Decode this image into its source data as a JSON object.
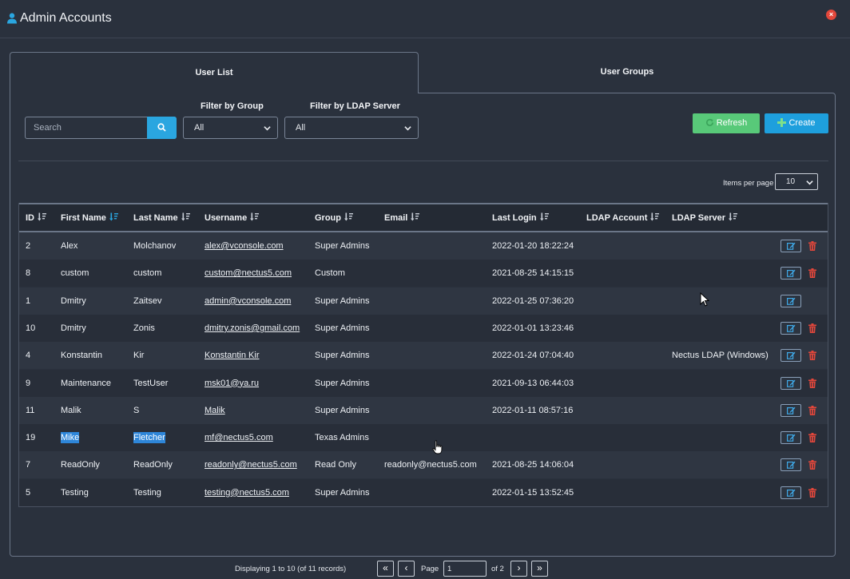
{
  "app": {
    "title": "Admin Accounts",
    "close_glyph": "×",
    "icons": {
      "title": "user-icon",
      "close": "close-icon"
    }
  },
  "tabs": [
    {
      "label": "User List",
      "active": true
    },
    {
      "label": "User Groups",
      "active": false
    }
  ],
  "toolbar": {
    "search_placeholder": "Search",
    "filter_group_label": "Filter by Group",
    "filter_group_value": "All",
    "filter_ldap_label": "Filter by LDAP Server",
    "filter_ldap_value": "All",
    "refresh_label": "Refresh",
    "create_label": "Create",
    "colors": {
      "refresh": "#58c979",
      "create": "#1e9fdd",
      "search": "#2aa6e0"
    }
  },
  "pagination": {
    "display_text": "Displaying 1 to 10 (of 11 records)",
    "first_glyph": "«",
    "prev_glyph": "‹",
    "next_glyph": "›",
    "last_glyph": "»",
    "page_label": "Page",
    "current_page": "1",
    "of_text": "of 2",
    "items_per_page_label": "Items per page",
    "items_per_page": "10"
  },
  "table": {
    "headers": [
      "ID",
      "First Name",
      "Last Name",
      "Username",
      "Group",
      "Email",
      "Last Login",
      "LDAP Account",
      "LDAP Server"
    ],
    "rows": [
      {
        "id": "2",
        "first": "Alex",
        "last": "Molchanov",
        "username": "alex@vconsole.com",
        "group": "Super Admins",
        "email": "",
        "last_login": "2022-01-20 18:22:24",
        "ldap_account": "",
        "ldap_server": "",
        "deletable": true
      },
      {
        "id": "8",
        "first": "custom",
        "last": "custom",
        "username": "custom@nectus5.com",
        "group": "Custom",
        "email": "",
        "last_login": "2021-08-25 14:15:15",
        "ldap_account": "",
        "ldap_server": "",
        "deletable": true
      },
      {
        "id": "1",
        "first": "Dmitry",
        "last": "Zaitsev",
        "username": "admin@vconsole.com",
        "group": "Super Admins",
        "email": "",
        "last_login": "2022-01-25 07:36:20",
        "ldap_account": "",
        "ldap_server": "",
        "deletable": false
      },
      {
        "id": "10",
        "first": "Dmitry",
        "last": "Zonis",
        "username": "dmitry.zonis@gmail.com",
        "group": "Super Admins",
        "email": "",
        "last_login": "2022-01-01 13:23:46",
        "ldap_account": "",
        "ldap_server": "",
        "deletable": true
      },
      {
        "id": "4",
        "first": "Konstantin",
        "last": "Kir",
        "username": "Konstantin Kir",
        "group": "Super Admins",
        "email": "",
        "last_login": "2022-01-24 07:04:40",
        "ldap_account": "",
        "ldap_server": "Nectus LDAP (Windows)",
        "deletable": true
      },
      {
        "id": "9",
        "first": "Maintenance",
        "last": "TestUser",
        "username": "msk01@ya.ru",
        "group": "Super Admins",
        "email": "",
        "last_login": "2021-09-13 06:44:03",
        "ldap_account": "",
        "ldap_server": "",
        "deletable": true
      },
      {
        "id": "11",
        "first": "Malik",
        "last": "S",
        "username": "Malik",
        "group": "Super Admins",
        "email": "",
        "last_login": "2022-01-11 08:57:16",
        "ldap_account": "",
        "ldap_server": "",
        "deletable": true
      },
      {
        "id": "19",
        "first": "Mike",
        "last": "Fletcher",
        "username": "mf@nectus5.com",
        "group": "Texas Admins",
        "email": "",
        "last_login": "",
        "ldap_account": "",
        "ldap_server": "",
        "deletable": true,
        "highlighted": true
      },
      {
        "id": "7",
        "first": "ReadOnly",
        "last": "ReadOnly",
        "username": "readonly@nectus5.com",
        "group": "Read Only",
        "email": "readonly@nectus5.com",
        "last_login": "2021-08-25 14:06:04",
        "ldap_account": "",
        "ldap_server": "",
        "deletable": true
      },
      {
        "id": "5",
        "first": "Testing",
        "last": "Testing",
        "username": "testing@nectus5.com",
        "group": "Super Admins",
        "email": "",
        "last_login": "2022-01-15 13:52:45",
        "ldap_account": "",
        "ldap_server": "",
        "deletable": true
      }
    ],
    "row_icons": {
      "edit": "edit-icon",
      "delete": "trash-icon"
    },
    "colors": {
      "delete": "#e2473b",
      "highlight": "#2e86d9"
    }
  }
}
